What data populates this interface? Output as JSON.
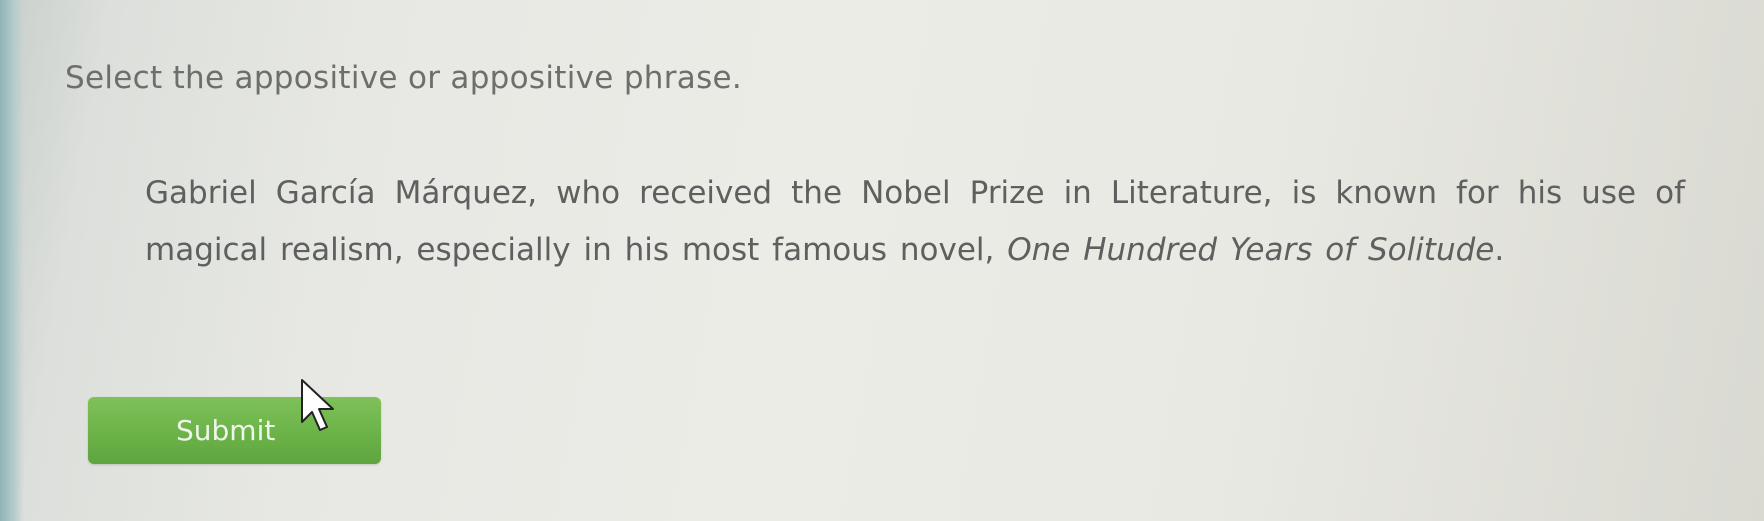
{
  "question": {
    "prompt": "Select the appositive or appositive phrase.",
    "sentence_main": "Gabriel García Márquez, who received the Nobel Prize in Literature, is known for his use of magical realism, especially in his most famous novel, ",
    "sentence_title": "One Hundred Years of Solitude",
    "sentence_end": "."
  },
  "actions": {
    "submit_label": "Submit"
  },
  "colors": {
    "submit_green": "#6bb348",
    "text_gray": "#5d605e"
  },
  "icons": {
    "pointer": "mouse-pointer-icon"
  }
}
